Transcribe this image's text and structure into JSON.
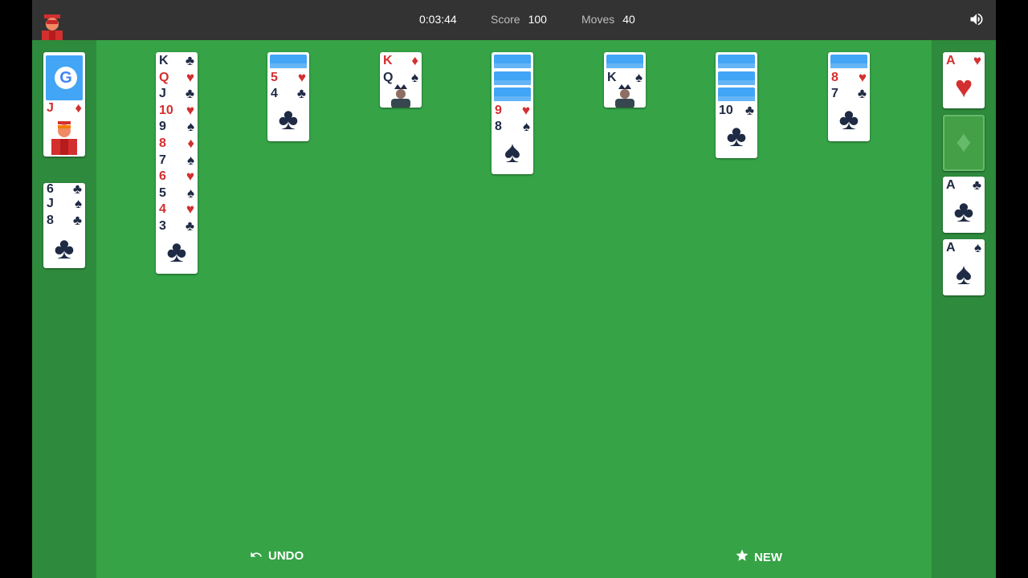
{
  "header": {
    "timer": "0:03:44",
    "score_label": "Score",
    "score_value": "100",
    "moves_label": "Moves",
    "moves_value": "40"
  },
  "icons": {
    "avatar": "player-avatar-icon",
    "sound": "speaker-icon",
    "undo": "undo-arrow-icon",
    "new": "star-icon",
    "stock": "google-logo-icon"
  },
  "stock": {
    "logo_letter": "G"
  },
  "waste": [
    {
      "rank": "J",
      "suit": "♦",
      "color": "red"
    }
  ],
  "reserve": [
    {
      "rank": "6",
      "suit": "♣",
      "color": "black"
    },
    {
      "rank": "J",
      "suit": "♠",
      "color": "black"
    },
    {
      "rank": "8",
      "suit": "♣",
      "color": "black"
    }
  ],
  "tableau": [
    {
      "hidden": 0,
      "cards": [
        {
          "rank": "K",
          "suit": "♣",
          "color": "black"
        },
        {
          "rank": "Q",
          "suit": "♥",
          "color": "red"
        },
        {
          "rank": "J",
          "suit": "♣",
          "color": "black"
        },
        {
          "rank": "10",
          "suit": "♥",
          "color": "red"
        },
        {
          "rank": "9",
          "suit": "♠",
          "color": "black"
        },
        {
          "rank": "8",
          "suit": "♦",
          "color": "red"
        },
        {
          "rank": "7",
          "suit": "♠",
          "color": "black"
        },
        {
          "rank": "6",
          "suit": "♥",
          "color": "red"
        },
        {
          "rank": "5",
          "suit": "♠",
          "color": "black"
        },
        {
          "rank": "4",
          "suit": "♥",
          "color": "red"
        },
        {
          "rank": "3",
          "suit": "♣",
          "color": "black"
        }
      ]
    },
    {
      "hidden": 1,
      "cards": [
        {
          "rank": "5",
          "suit": "♥",
          "color": "red"
        },
        {
          "rank": "4",
          "suit": "♣",
          "color": "black"
        }
      ]
    },
    {
      "hidden": 0,
      "cards": [
        {
          "rank": "K",
          "suit": "♦",
          "color": "red"
        },
        {
          "rank": "Q",
          "suit": "♠",
          "color": "black"
        }
      ]
    },
    {
      "hidden": 3,
      "cards": [
        {
          "rank": "9",
          "suit": "♥",
          "color": "red"
        },
        {
          "rank": "8",
          "suit": "♠",
          "color": "black"
        }
      ]
    },
    {
      "hidden": 1,
      "cards": [
        {
          "rank": "K",
          "suit": "♠",
          "color": "black"
        }
      ]
    },
    {
      "hidden": 3,
      "cards": [
        {
          "rank": "10",
          "suit": "♣",
          "color": "black"
        }
      ]
    },
    {
      "hidden": 1,
      "cards": [
        {
          "rank": "8",
          "suit": "♥",
          "color": "red"
        },
        {
          "rank": "7",
          "suit": "♣",
          "color": "black"
        }
      ]
    }
  ],
  "foundations": [
    {
      "rank": "A",
      "suit": "♥",
      "color": "red",
      "empty": false
    },
    {
      "rank": "",
      "suit": "♦",
      "color": "red",
      "empty": true
    },
    {
      "rank": "A",
      "suit": "♣",
      "color": "black",
      "empty": false
    },
    {
      "rank": "A",
      "suit": "♠",
      "color": "black",
      "empty": false
    }
  ],
  "controls": {
    "undo_label": "UNDO",
    "new_label": "NEW"
  },
  "colors": {
    "felt": "#35a346",
    "rail": "#2e8a3c",
    "topbar": "#333333",
    "card_back": "#42a5f5",
    "red_suit": "#d32f2f",
    "black_suit": "#1f2a44"
  }
}
